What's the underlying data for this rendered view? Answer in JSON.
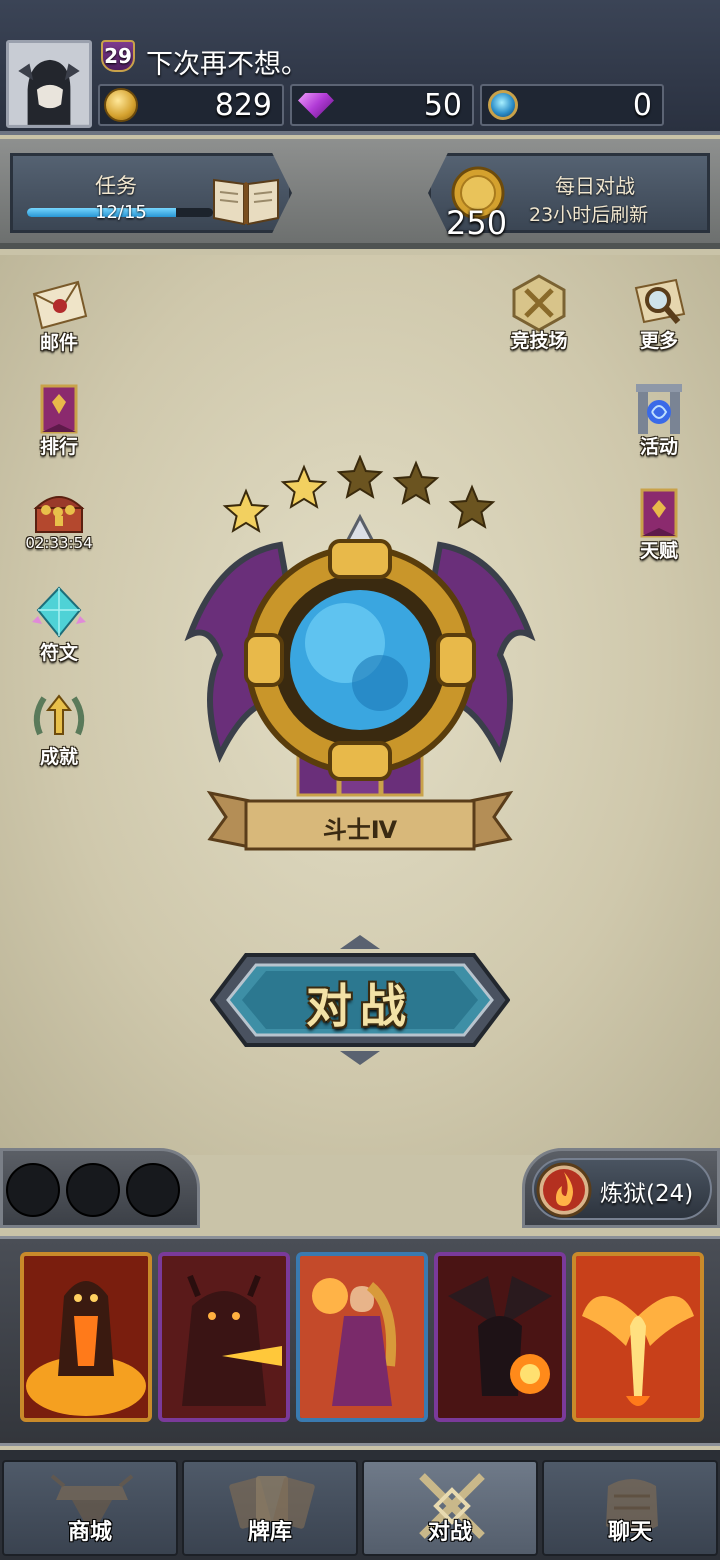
{
  "player": {
    "level": "29",
    "name": "下次再不想。"
  },
  "resources": {
    "gold": "829",
    "gems": "50",
    "orbs": "0"
  },
  "quest": {
    "label": "任务",
    "progress_text": "12/15",
    "progress_fraction": 0.8
  },
  "daily": {
    "reward": "250",
    "title": "每日对战",
    "refresh_text": "23小时后刷新"
  },
  "left_menu": {
    "mail": "邮件",
    "ranking": "排行",
    "chest_timer": "02:33:54",
    "runes": "符文",
    "achievements": "成就"
  },
  "right_menu": {
    "arena": "竞技场",
    "more": "更多",
    "events": "活动",
    "talents": "天赋"
  },
  "rank": {
    "name": "斗士Ⅳ",
    "stars_filled": 2,
    "stars_total": 5
  },
  "fight_button": "对战",
  "deck": {
    "name": "炼狱(24)"
  },
  "nav": {
    "shop": "商城",
    "deck": "牌库",
    "battle": "对战",
    "chat": "聊天"
  },
  "colors": {
    "accent_gold": "#d4a12e",
    "star_filled": "#f2d060",
    "star_empty": "#6b5420",
    "card_border": "#c98a2a",
    "button_teal": "#3e8fa6"
  }
}
